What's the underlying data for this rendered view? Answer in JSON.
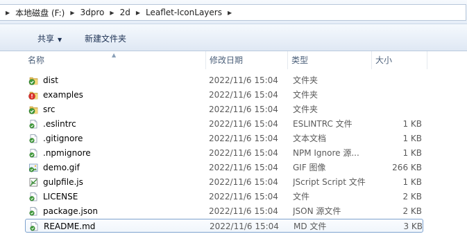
{
  "breadcrumb": [
    {
      "label": "本地磁盘 (F:)"
    },
    {
      "label": "3dpro"
    },
    {
      "label": "2d"
    },
    {
      "label": "Leaflet-IconLayers"
    }
  ],
  "toolbar": {
    "share_label": "共享",
    "new_folder_label": "新建文件夹"
  },
  "columns": {
    "name": "名称",
    "date": "修改日期",
    "type": "类型",
    "size": "大小"
  },
  "files": [
    {
      "name": "dist",
      "date": "2022/11/6 15:04",
      "type": "文件夹",
      "size": "",
      "icon": "folder-icon"
    },
    {
      "name": "examples",
      "date": "2022/11/6 15:04",
      "type": "文件夹",
      "size": "",
      "icon": "folder-warning-icon"
    },
    {
      "name": "src",
      "date": "2022/11/6 15:04",
      "type": "文件夹",
      "size": "",
      "icon": "folder-icon"
    },
    {
      "name": ".eslintrc",
      "date": "2022/11/6 15:04",
      "type": "ESLINTRC 文件",
      "size": "1 KB",
      "icon": "file-icon"
    },
    {
      "name": ".gitignore",
      "date": "2022/11/6 15:04",
      "type": "文本文档",
      "size": "1 KB",
      "icon": "file-icon"
    },
    {
      "name": ".npmignore",
      "date": "2022/11/6 15:04",
      "type": "NPM Ignore 源...",
      "size": "1 KB",
      "icon": "file-icon"
    },
    {
      "name": "demo.gif",
      "date": "2022/11/6 15:04",
      "type": "GIF 图像",
      "size": "266 KB",
      "icon": "image-icon"
    },
    {
      "name": "gulpfile.js",
      "date": "2022/11/6 15:04",
      "type": "JScript Script 文件",
      "size": "1 KB",
      "icon": "script-icon"
    },
    {
      "name": "LICENSE",
      "date": "2022/11/6 15:04",
      "type": "文件",
      "size": "2 KB",
      "icon": "file-icon"
    },
    {
      "name": "package.json",
      "date": "2022/11/6 15:04",
      "type": "JSON 源文件",
      "size": "2 KB",
      "icon": "file-icon"
    },
    {
      "name": "README.md",
      "date": "2022/11/6 15:04",
      "type": "MD 文件",
      "size": "3 KB",
      "icon": "file-icon",
      "selected": true
    }
  ]
}
